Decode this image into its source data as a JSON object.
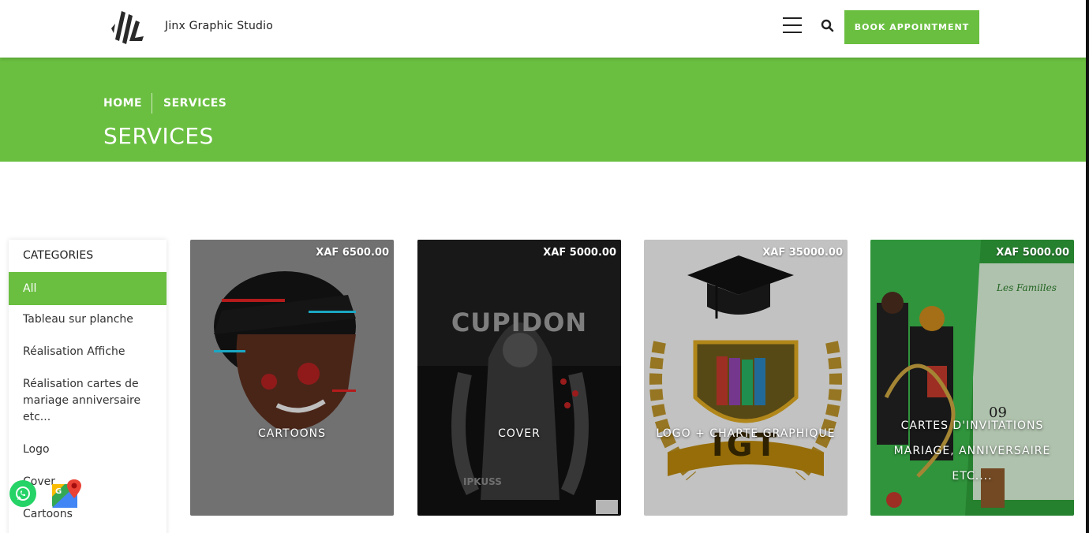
{
  "header": {
    "brand": "Jinx Graphic Studio",
    "book_label": "BOOK APPOINTMENT"
  },
  "banner": {
    "breadcrumb_home": "HOME",
    "breadcrumb_current": "SERVICES",
    "title": "SERVICES"
  },
  "sidebar": {
    "title": "CATEGORIES",
    "items": [
      {
        "label": "All"
      },
      {
        "label": "Tableau sur planche"
      },
      {
        "label": "Réalisation Affiche"
      },
      {
        "label": "Réalisation cartes de mariage anniversaire etc..."
      },
      {
        "label": "Logo"
      },
      {
        "label": "Cover"
      },
      {
        "label": "Cartoons"
      }
    ]
  },
  "cards": [
    {
      "title": "CARTOONS",
      "price": "XAF 6500.00"
    },
    {
      "title": "COVER",
      "price": "XAF 5000.00",
      "art_text": "CUPIDON",
      "art_sub": "IPKUSS"
    },
    {
      "title": "LOGO + CHARTE GRAPHIQUE",
      "price": "XAF 35000.00",
      "art_text": "IGT"
    },
    {
      "title": "CARTES D'INVITATIONS MARIAGE, ANNIVERSAIRE ETC....",
      "price": "XAF 5000.00",
      "art_text": "Les Familles",
      "art_date": "09"
    }
  ],
  "colors": {
    "accent": "#6abf40",
    "header_bg": "#ffffff",
    "text_dark": "#222222"
  },
  "icons": {
    "logo": "jinx-logo-icon",
    "menu": "hamburger-menu-icon",
    "search": "search-icon",
    "whatsapp": "whatsapp-icon",
    "maps": "google-maps-icon"
  }
}
